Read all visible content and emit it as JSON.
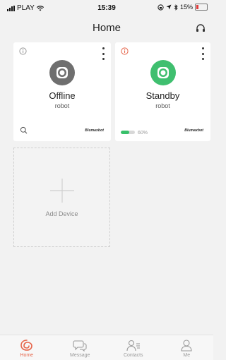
{
  "status_bar": {
    "carrier": "PLAY",
    "time": "15:39",
    "battery_percent": "15%"
  },
  "header": {
    "title": "Home",
    "action_icon": "headset-icon"
  },
  "devices": [
    {
      "status": "Offline",
      "name": "robot",
      "corner_icon": "info-icon",
      "robot_color": "#6f6f6f",
      "bottom_icon": "search-icon",
      "brand": "Blumaxbot"
    },
    {
      "status": "Standby",
      "name": "robot",
      "corner_icon": "info-icon",
      "robot_color": "#3fbf6f",
      "battery_level": 0.6,
      "battery_text": "60%",
      "brand": "Blumaxbot"
    }
  ],
  "add_device": {
    "label": "Add Device"
  },
  "tabs": [
    {
      "label": "Home",
      "icon": "home-icon",
      "active": true
    },
    {
      "label": "Message",
      "icon": "message-icon",
      "active": false
    },
    {
      "label": "Contacts",
      "icon": "contacts-icon",
      "active": false
    },
    {
      "label": "Me",
      "icon": "person-icon",
      "active": false
    }
  ],
  "colors": {
    "accent": "#e6654a",
    "online": "#3fbf6f",
    "offline": "#6f6f6f"
  }
}
